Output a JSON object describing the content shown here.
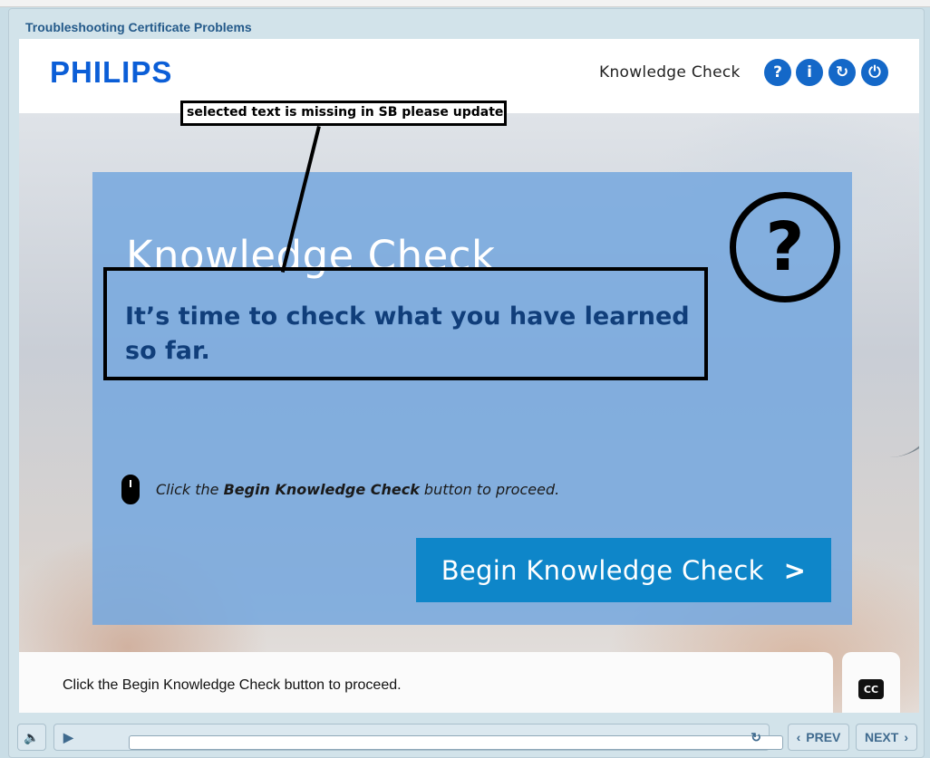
{
  "course": {
    "title": "Troubleshooting Certificate Problems"
  },
  "header": {
    "logo": "PHILIPS",
    "title": "Knowledge Check",
    "buttons": {
      "help": "?",
      "info": "i",
      "replay": "↻",
      "exit": "⏻"
    }
  },
  "panel": {
    "heading": "Knowledge Check",
    "subtitle": "It’s time to check what you have learned so far.",
    "question_icon": "?",
    "instruction_prefix": "Click the ",
    "instruction_bold": "Begin Knowledge Check",
    "instruction_suffix": " button to proceed.",
    "begin_label": "Begin Knowledge Check",
    "begin_chevron": ">"
  },
  "annotation": {
    "note": "selected text is missing in SB please update"
  },
  "caption": {
    "text": "Click the Begin Knowledge Check button to proceed.",
    "cc_label": "CC"
  },
  "controls": {
    "volume_icon": "🔈",
    "play_icon": "▶",
    "reload_icon": "↻",
    "prev_label": "PREV",
    "prev_chevron": "‹",
    "next_label": "NEXT",
    "next_chevron": "›"
  },
  "colors": {
    "accent": "#1468c8",
    "panel": "#76a8de",
    "button": "#0e86c9",
    "subtitle": "#103e7a"
  }
}
